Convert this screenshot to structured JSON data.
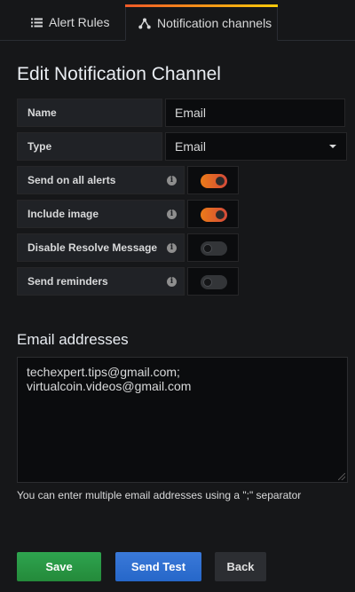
{
  "tabs": [
    {
      "label": "Alert Rules",
      "icon": "list-icon",
      "active": false
    },
    {
      "label": "Notification channels",
      "icon": "share-nodes-icon",
      "active": true
    }
  ],
  "page_title": "Edit Notification Channel",
  "form": {
    "name": {
      "label": "Name",
      "value": "Email"
    },
    "type": {
      "label": "Type",
      "value": "Email"
    },
    "toggles": [
      {
        "label": "Send on all alerts",
        "on": true
      },
      {
        "label": "Include image",
        "on": true
      },
      {
        "label": "Disable Resolve Message",
        "on": false
      },
      {
        "label": "Send reminders",
        "on": false
      }
    ]
  },
  "email": {
    "heading": "Email addresses",
    "addresses": [
      "techexpert.tips@gmail.com;",
      "virtualcoin.videos@gmail.com"
    ],
    "helper": "You can enter multiple email addresses using a \";\" separator"
  },
  "buttons": {
    "save": "Save",
    "test": "Send Test",
    "back": "Back"
  },
  "colors": {
    "background": "#161719",
    "toggle_on": "#eb7b18",
    "save": "#2ea44f",
    "test": "#3a79d9"
  }
}
